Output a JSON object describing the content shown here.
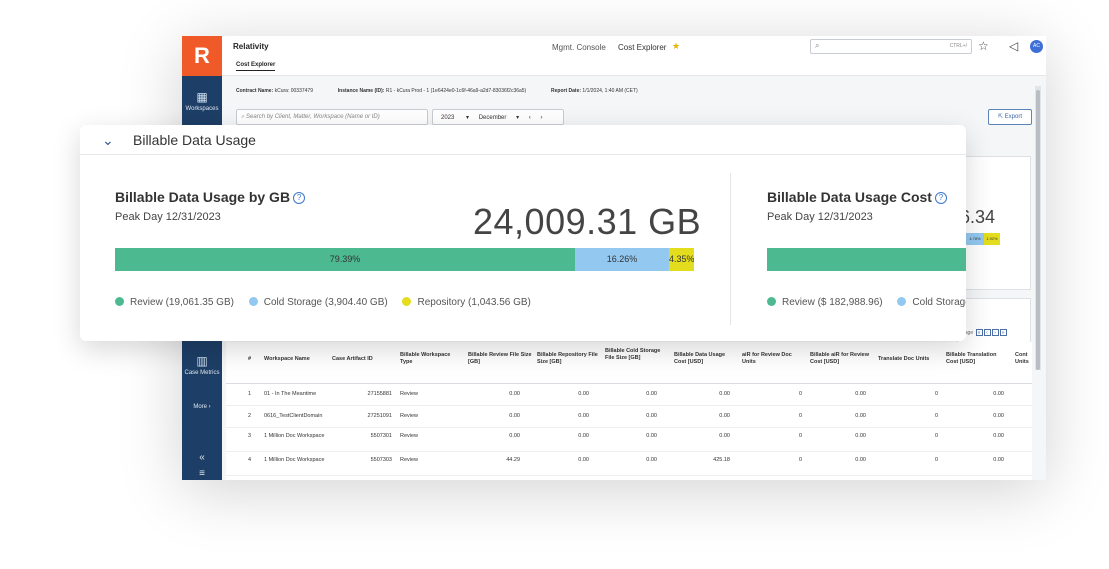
{
  "app": {
    "logo": "R",
    "title": "Relativity",
    "active_tab": "Cost Explorer",
    "nav_links": [
      "Mgmt. Console",
      "Cost Explorer"
    ],
    "search_shortcut": "CTRL+/",
    "avatar": "AC",
    "icons": [
      "search-icon",
      "star-icon",
      "megaphone-icon",
      "favorite-star-icon",
      "chevron-down-icon",
      "export-icon",
      "help-icon"
    ]
  },
  "sidebar": {
    "items": [
      {
        "label": "Workspaces",
        "icon": "workspaces-icon"
      },
      {
        "label": "Case Metrics",
        "icon": "bar-chart-icon"
      },
      {
        "label": "More",
        "icon": "chevron-right-icon"
      }
    ],
    "collapse": "«",
    "menu": "≡"
  },
  "info": {
    "contract_label": "Contract Name:",
    "contract_value": "kCura: 00337479",
    "instance_label": "Instance Name (ID):",
    "instance_value": "R1 - kCura Prod - 1 (1e6424e0-1c6f-46a9-a2d7-83036f2c36a5)",
    "report_label": "Report Date:",
    "report_value": "1/1/2024, 1:40 AM (CET)"
  },
  "filters": {
    "search_placeholder": "Search by Client, Matter, Workspace (Name or ID)",
    "year": "2023",
    "month": "December",
    "export_label": "Export"
  },
  "card": {
    "section_title": "Billable Data Usage",
    "gb_title": "Billable Data Usage by GB",
    "gb_peak": "Peak Day 12/31/2023",
    "gb_total": "24,009.31 GB",
    "segments": [
      {
        "label": "79.39%",
        "pct": 79.39,
        "color": "#4cb991"
      },
      {
        "label": "16.26%",
        "pct": 16.26,
        "color": "#93c8f0"
      },
      {
        "label": "4.35%",
        "pct": 4.35,
        "color": "#e3dd1e"
      }
    ],
    "legend": [
      {
        "label": "Review (19,061.35 GB)",
        "color": "#4cb991"
      },
      {
        "label": "Cold Storage (3,904.40 GB)",
        "color": "#93c8f0"
      },
      {
        "label": "Repository (1,043.56 GB)",
        "color": "#e3dd1e"
      }
    ],
    "cost_title": "Billable Data Usage Cost",
    "cost_peak": "Peak Day 12/31/2023",
    "cost_legend": [
      {
        "label": "Review ($ 182,988.96)",
        "color": "#4cb991"
      },
      {
        "label": "Cold Storage ($",
        "color": "#93c8f0"
      }
    ]
  },
  "behind": {
    "cost_partial": "6.34",
    "mini_segments": [
      "4.78%",
      "1.92%"
    ],
    "pager_label": "page"
  },
  "table": {
    "columns": [
      "#",
      "Workspace Name",
      "Case Artifact ID",
      "Billable Workspace Type",
      "Billable Review File Size [GB]",
      "Billable Repository File Size [GB]",
      "Billable Cold Storage File Size [GB]",
      "Billable Data Usage Cost [USD]",
      "aiR for Review Doc Units",
      "Billable aiR for Review Cost [USD]",
      "Translate Doc Units",
      "Billable Translation Cost [USD]",
      "Cont Units"
    ],
    "rows": [
      [
        "1",
        "01 - In The Meantime",
        "27155881",
        "Review",
        "0.00",
        "0.00",
        "0.00",
        "0.00",
        "0",
        "0.00",
        "0",
        "0.00"
      ],
      [
        "2",
        "0616_TestClientDomain",
        "27251091",
        "Review",
        "0.00",
        "0.00",
        "0.00",
        "0.00",
        "0",
        "0.00",
        "0",
        "0.00"
      ],
      [
        "3",
        "1 Million Doc Workspace",
        "5507301",
        "Review",
        "0.00",
        "0.00",
        "0.00",
        "0.00",
        "0",
        "0.00",
        "0",
        "0.00"
      ],
      [
        "4",
        "1 Million Doc Workspace",
        "5507303",
        "Review",
        "44.29",
        "0.00",
        "0.00",
        "425.18",
        "0",
        "0.00",
        "0",
        "0.00"
      ]
    ]
  }
}
